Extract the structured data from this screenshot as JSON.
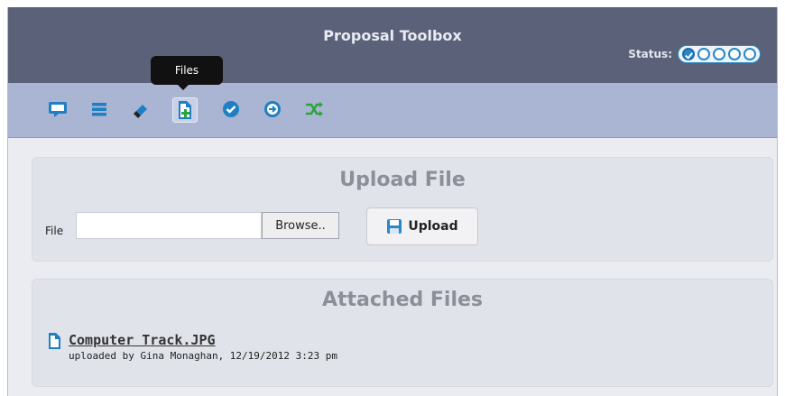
{
  "app": {
    "title": "Proposal Toolbox",
    "status_label": "Status:",
    "status_steps_total": 5,
    "status_steps_completed": 1
  },
  "toolbar": {
    "active_tool": "files",
    "tooltip": "Files",
    "tools": [
      {
        "id": "comments",
        "icon": "speech-bubble-icon"
      },
      {
        "id": "list",
        "icon": "list-icon"
      },
      {
        "id": "edit",
        "icon": "eraser-icon"
      },
      {
        "id": "files",
        "icon": "file-add-icon"
      },
      {
        "id": "approve",
        "icon": "check-circle-icon"
      },
      {
        "id": "forward",
        "icon": "arrow-circle-icon"
      },
      {
        "id": "shuffle",
        "icon": "shuffle-icon"
      }
    ]
  },
  "upload": {
    "title": "Upload File",
    "file_label": "File",
    "file_value": "",
    "browse_label": "Browse..",
    "upload_label": "Upload"
  },
  "attached": {
    "title": "Attached Files",
    "files": [
      {
        "name": "Computer Track.JPG",
        "meta": "uploaded by Gina Monaghan,  12/19/2012 3:23 pm"
      }
    ]
  },
  "colors": {
    "header_bg": "#5b6178",
    "toolbar_bg": "#aab4d3",
    "accent": "#2b86c5",
    "panel_bg": "#e1e3ea"
  }
}
